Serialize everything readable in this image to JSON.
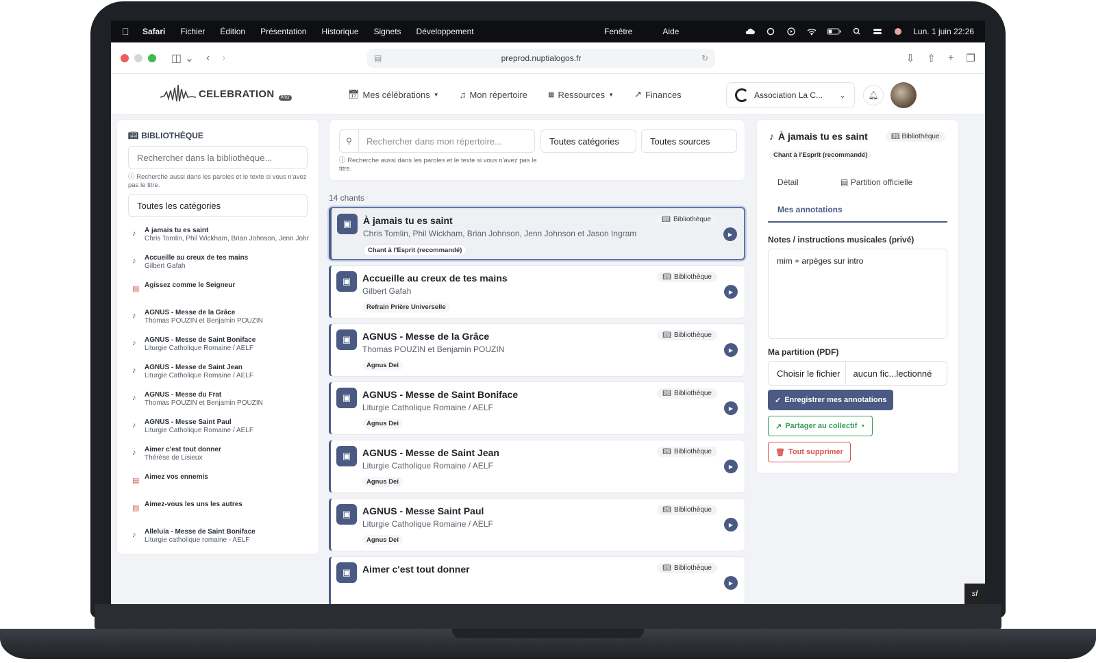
{
  "menubar": {
    "app": "Safari",
    "items": [
      "Fichier",
      "Édition",
      "Présentation",
      "Historique",
      "Signets",
      "Développement"
    ],
    "center_items": [
      "Fenêtre",
      "Aide"
    ],
    "clock": "Lun. 1 juin  22:26"
  },
  "browser": {
    "url": "preprod.nuptialogos.fr"
  },
  "header": {
    "logo_text": "CELEBRATION",
    "logo_badge": "PRO",
    "nav": [
      {
        "label": "Mes célébrations",
        "icon": "calendar-icon",
        "dropdown": true
      },
      {
        "label": "Mon répertoire",
        "icon": "music-note-icon"
      },
      {
        "label": "Ressources",
        "icon": "grid-icon",
        "dropdown": true
      },
      {
        "label": "Finances",
        "icon": "chart-line-icon"
      }
    ],
    "org_name": "Association La C..."
  },
  "library": {
    "title": "BIBLIOTHÈQUE",
    "search_placeholder": "Rechercher dans la bibliothèque...",
    "hint": "ⓘ Recherche aussi dans les paroles et le texte si vous n'avez pas le titre.",
    "category_select": "Toutes les catégories",
    "items": [
      {
        "title": "À jamais tu es saint",
        "subtitle": "Chris Tomlin, Phil Wickham, Brian Johnson, Jenn Johnson et Jason Ingram",
        "type": "music"
      },
      {
        "title": "Accueille au creux de tes mains",
        "subtitle": "Gilbert Gafah",
        "type": "music"
      },
      {
        "title": "Agissez comme le Seigneur",
        "subtitle": "",
        "type": "doc"
      },
      {
        "title": "AGNUS - Messe de la Grâce",
        "subtitle": "Thomas POUZIN et Benjamin POUZIN",
        "type": "music"
      },
      {
        "title": "AGNUS - Messe de Saint Boniface",
        "subtitle": "Liturgie Catholique Romaine / AELF",
        "type": "music"
      },
      {
        "title": "AGNUS - Messe de Saint Jean",
        "subtitle": "Liturgie Catholique Romaine / AELF",
        "type": "music"
      },
      {
        "title": "AGNUS - Messe du Frat",
        "subtitle": "Thomas POUZIN et Benjamin POUZIN",
        "type": "music"
      },
      {
        "title": "AGNUS - Messe Saint Paul",
        "subtitle": "Liturgie Catholique Romaine / AELF",
        "type": "music"
      },
      {
        "title": "Aimer c'est tout donner",
        "subtitle": "Thérèse de Lisieux",
        "type": "music"
      },
      {
        "title": "Aimez vos ennemis",
        "subtitle": "",
        "type": "doc"
      },
      {
        "title": "Aimez-vous les uns les autres",
        "subtitle": "",
        "type": "doc"
      },
      {
        "title": "Alleluia - Messe de Saint Boniface",
        "subtitle": "Liturgie catholique romaine - AELF",
        "type": "music"
      }
    ]
  },
  "repertoire": {
    "search_placeholder": "Rechercher dans mon répertoire...",
    "filter_category": "Toutes catégories",
    "filter_source": "Toutes sources",
    "hint": "ⓘ Recherche aussi dans les paroles et le texte si vous n'avez pas le titre.",
    "count": "14 chants",
    "songs": [
      {
        "title": "À jamais tu es saint",
        "author": "Chris Tomlin, Phil Wickham, Brian Johnson, Jenn Johnson et Jason Ingram",
        "category": "Chant à l'Esprit (recommandé)",
        "source": "Bibliothèque",
        "active": true
      },
      {
        "title": "Accueille au creux de tes mains",
        "author": "Gilbert Gafah",
        "category": "Refrain Prière Universelle",
        "source": "Bibliothèque"
      },
      {
        "title": "AGNUS - Messe de la Grâce",
        "author": "Thomas POUZIN et Benjamin POUZIN",
        "category": "Agnus Dei",
        "source": "Bibliothèque"
      },
      {
        "title": "AGNUS - Messe de Saint Boniface",
        "author": "Liturgie Catholique Romaine / AELF",
        "category": "Agnus Dei",
        "source": "Bibliothèque"
      },
      {
        "title": "AGNUS - Messe de Saint Jean",
        "author": "Liturgie Catholique Romaine / AELF",
        "category": "Agnus Dei",
        "source": "Bibliothèque"
      },
      {
        "title": "AGNUS - Messe Saint Paul",
        "author": "Liturgie Catholique Romaine / AELF",
        "category": "Agnus Dei",
        "source": "Bibliothèque"
      },
      {
        "title": "Aimer c'est tout donner",
        "author": "",
        "category": "",
        "source": "Bibliothèque"
      }
    ]
  },
  "detail": {
    "title": "À jamais tu es saint",
    "source": "Bibliothèque",
    "category": "Chant à l'Esprit (recommandé)",
    "tabs": [
      "Détail",
      "Partition officielle",
      "Mes annotations"
    ],
    "notes_label": "Notes / instructions musicales (privé)",
    "notes_value": "mim + arpèges sur intro",
    "pdf_label": "Ma partition (PDF)",
    "file_button": "Choisir le fichier",
    "file_name": "aucun fic...lectionné",
    "save_button": "Enregistrer mes annotations",
    "share_button": "Partager au collectif",
    "delete_button": "Tout supprimer"
  },
  "colors": {
    "primary": "#4b5a82",
    "success": "#2f9e58",
    "danger": "#d9534f"
  }
}
